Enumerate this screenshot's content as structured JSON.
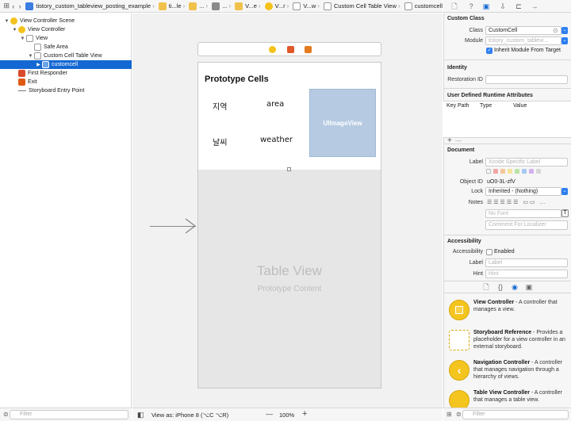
{
  "breadcrumb": {
    "items": [
      {
        "label": "tistory_custom_tableview_posting_example",
        "icon": "project-icon"
      },
      {
        "label": "ti...le",
        "icon": "folder-icon"
      },
      {
        "label": "...",
        "icon": "folder-icon"
      },
      {
        "label": "...",
        "icon": "file-icon"
      },
      {
        "label": "V...e",
        "icon": "folder-icon"
      },
      {
        "label": "V...r",
        "icon": "view-controller-icon"
      },
      {
        "label": "V...w",
        "icon": "view-icon"
      },
      {
        "label": "Custom Cell Table View",
        "icon": "table-view-icon"
      },
      {
        "label": "customcell",
        "icon": "cell-icon"
      }
    ]
  },
  "outline": {
    "items": [
      {
        "label": "View Controller Scene",
        "indent": 0,
        "expand": "▼",
        "icon": "scene-icon"
      },
      {
        "label": "View Controller",
        "indent": 1,
        "expand": "▼",
        "icon": "view-controller-icon"
      },
      {
        "label": "View",
        "indent": 2,
        "expand": "▼",
        "icon": "view-icon"
      },
      {
        "label": "Safe Area",
        "indent": 3,
        "expand": "",
        "icon": "safe-area-icon"
      },
      {
        "label": "Custom Cell Table View",
        "indent": 3,
        "expand": "▼",
        "icon": "table-view-icon"
      },
      {
        "label": "customcell",
        "indent": 4,
        "expand": "▶",
        "icon": "cell-icon",
        "selected": true
      },
      {
        "label": "First Responder",
        "indent": 1,
        "expand": "",
        "icon": "first-responder-icon"
      },
      {
        "label": "Exit",
        "indent": 1,
        "expand": "",
        "icon": "exit-icon"
      },
      {
        "label": "Storyboard Entry Point",
        "indent": 1,
        "expand": "",
        "icon": "entry-point-icon"
      }
    ],
    "filter_placeholder": "Filter"
  },
  "canvas": {
    "prototype_caption": "Prototype Cells",
    "cell_labels": [
      "지역",
      "area",
      "날씨",
      "weather"
    ],
    "image_view_label": "UIImageView",
    "table_view_label": "Table View",
    "prototype_content_label": "Prototype Content",
    "bottom": {
      "view_as": "View as: iPhone 8 (⌥C ⌥R)",
      "zoom_minus": "—",
      "zoom": "100%",
      "zoom_plus": "+"
    }
  },
  "inspector": {
    "custom_class": {
      "heading": "Custom Class",
      "class_label": "Class",
      "class_value": "CustomCell",
      "module_label": "Module",
      "module_value": "tistory_custom_tablevi...",
      "inherit_label": "Inherit Module From Target"
    },
    "identity": {
      "heading": "Identity",
      "restoration_label": "Restoration ID",
      "restoration_value": ""
    },
    "runtime": {
      "heading": "User Defined Runtime Attributes",
      "col_keypath": "Key Path",
      "col_type": "Type",
      "col_value": "Value",
      "add": "+",
      "remove": "—"
    },
    "document": {
      "heading": "Document",
      "label_label": "Label",
      "label_placeholder": "Xcode Specific Label",
      "object_id_label": "Object ID",
      "object_id_value": "uO0-3L-zfV",
      "lock_label": "Lock",
      "lock_value": "Inherited - (Nothing)",
      "notes_label": "Notes",
      "font_placeholder": "No Font",
      "comment_placeholder": "Comment For Localizer",
      "label_colors": [
        "#cccccc",
        "#f2a6a6",
        "#f5c79a",
        "#f5e49a",
        "#b9e3a7",
        "#a6c8f2",
        "#d2b2ee",
        "#d6d6d6"
      ]
    },
    "accessibility": {
      "heading": "Accessibility",
      "accessibility_label": "Accessibility",
      "enabled_label": "Enabled",
      "label_label": "Label",
      "label_placeholder": "Label",
      "hint_label": "Hint",
      "hint_placeholder": "Hint"
    },
    "library": {
      "items": [
        {
          "title": "View Controller",
          "desc": " - A controller that manages a view.",
          "icon": "view-controller-icon"
        },
        {
          "title": "Storyboard Reference",
          "desc": " - Provides a placeholder for a view controller in an external storyboard.",
          "icon": "storyboard-reference-icon"
        },
        {
          "title": "Navigation Controller",
          "desc": " - A controller that manages navigation through a hierarchy of views.",
          "icon": "navigation-controller-icon"
        },
        {
          "title": "Table View Controller",
          "desc": " - A controller that manages a table view.",
          "icon": "table-view-controller-icon"
        }
      ],
      "filter_placeholder": "Filter"
    }
  },
  "colors": {
    "accent": "#1468d3",
    "image_view": "#b6cbe2",
    "library_icon": "#f5c51f"
  }
}
